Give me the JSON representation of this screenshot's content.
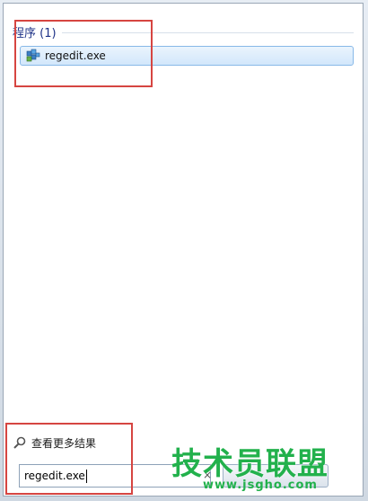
{
  "programs_group": {
    "title": "程序 (1)"
  },
  "results": [
    {
      "label": "regedit.exe",
      "icon": "registry-editor-icon"
    }
  ],
  "see_more": {
    "label": "查看更多结果",
    "icon": "search-icon"
  },
  "search": {
    "value": "regedit.exe",
    "clear_glyph": "×"
  },
  "watermark": {
    "title": "技术员联盟",
    "url": "www.jsgho.com"
  },
  "colors": {
    "highlight": "#d64541",
    "accent": "#1e3287",
    "watermark": "#22b14c"
  }
}
